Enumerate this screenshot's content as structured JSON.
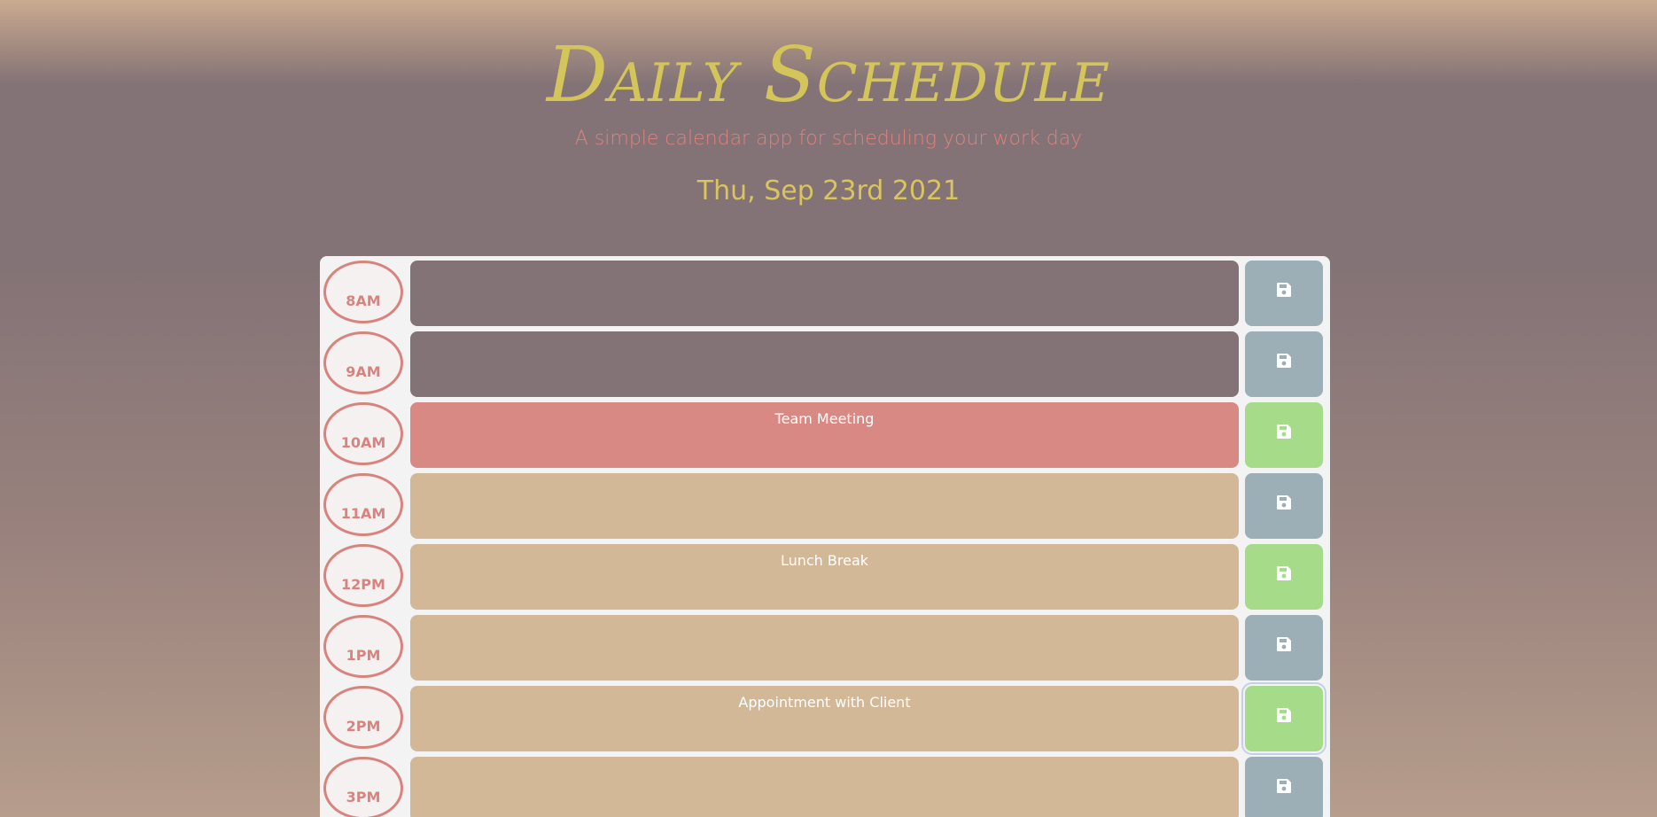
{
  "header": {
    "title": "Daily Schedule",
    "subtitle": "A simple calendar app for scheduling your work day",
    "date": "Thu, Sep 23rd 2021"
  },
  "colors": {
    "title": "#d3c55a",
    "subtitle": "#e0817d",
    "past": "#837376",
    "present": "#d98984",
    "future": "#d3b898",
    "save_default": "#9dafb6",
    "save_saved": "#a5db89"
  },
  "rows": [
    {
      "hour": "8AM",
      "text": "",
      "status": "past",
      "saved": false,
      "save_icon": "floppy-disk-icon"
    },
    {
      "hour": "9AM",
      "text": "",
      "status": "past",
      "saved": false,
      "save_icon": "floppy-disk-icon"
    },
    {
      "hour": "10AM",
      "text": "Team Meeting",
      "status": "present",
      "saved": true,
      "save_icon": "floppy-disk-icon"
    },
    {
      "hour": "11AM",
      "text": "",
      "status": "future",
      "saved": false,
      "save_icon": "floppy-disk-icon"
    },
    {
      "hour": "12PM",
      "text": "Lunch Break",
      "status": "future",
      "saved": true,
      "save_icon": "floppy-disk-icon"
    },
    {
      "hour": "1PM",
      "text": "",
      "status": "future",
      "saved": false,
      "save_icon": "floppy-disk-icon"
    },
    {
      "hour": "2PM",
      "text": "Appointment with Client",
      "status": "future",
      "saved": true,
      "focused": true,
      "save_icon": "floppy-disk-icon"
    },
    {
      "hour": "3PM",
      "text": "",
      "status": "future",
      "saved": false,
      "save_icon": "floppy-disk-icon"
    }
  ]
}
